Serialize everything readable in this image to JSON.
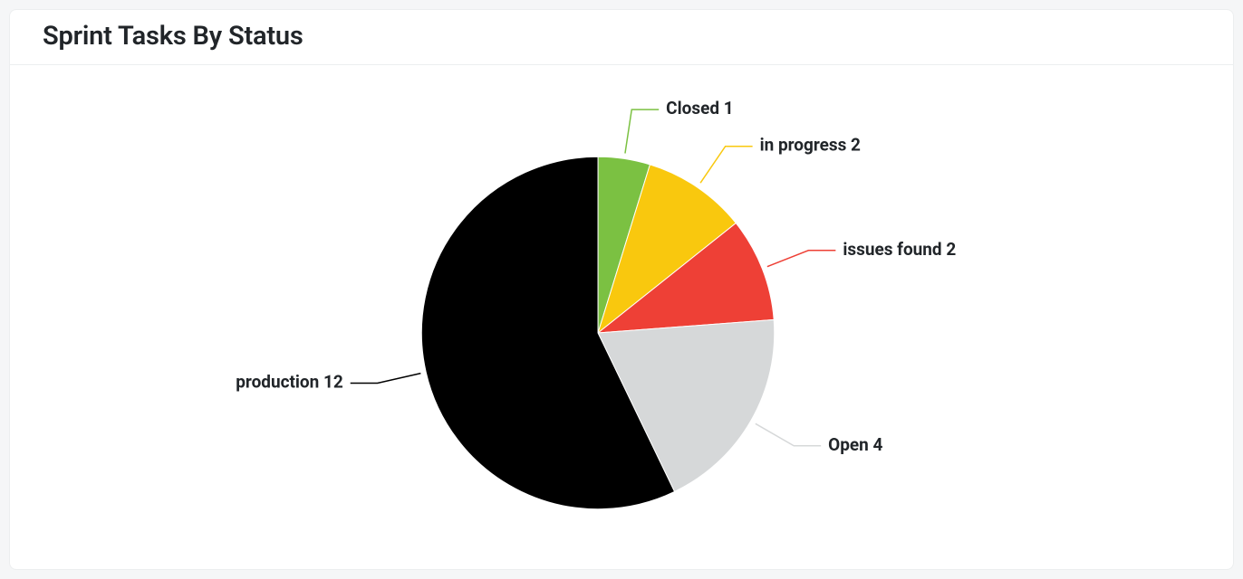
{
  "header": {
    "title": "Sprint Tasks By Status"
  },
  "chart_data": {
    "type": "pie",
    "title": "Sprint Tasks By Status",
    "series": [
      {
        "name": "Closed",
        "value": 1,
        "color": "#7bc142"
      },
      {
        "name": "in progress",
        "value": 2,
        "color": "#f9c80e"
      },
      {
        "name": "issues found",
        "value": 2,
        "color": "#ee4036"
      },
      {
        "name": "Open",
        "value": 4,
        "color": "#d6d8d9"
      },
      {
        "name": "production",
        "value": 12,
        "color": "#000000"
      }
    ]
  }
}
